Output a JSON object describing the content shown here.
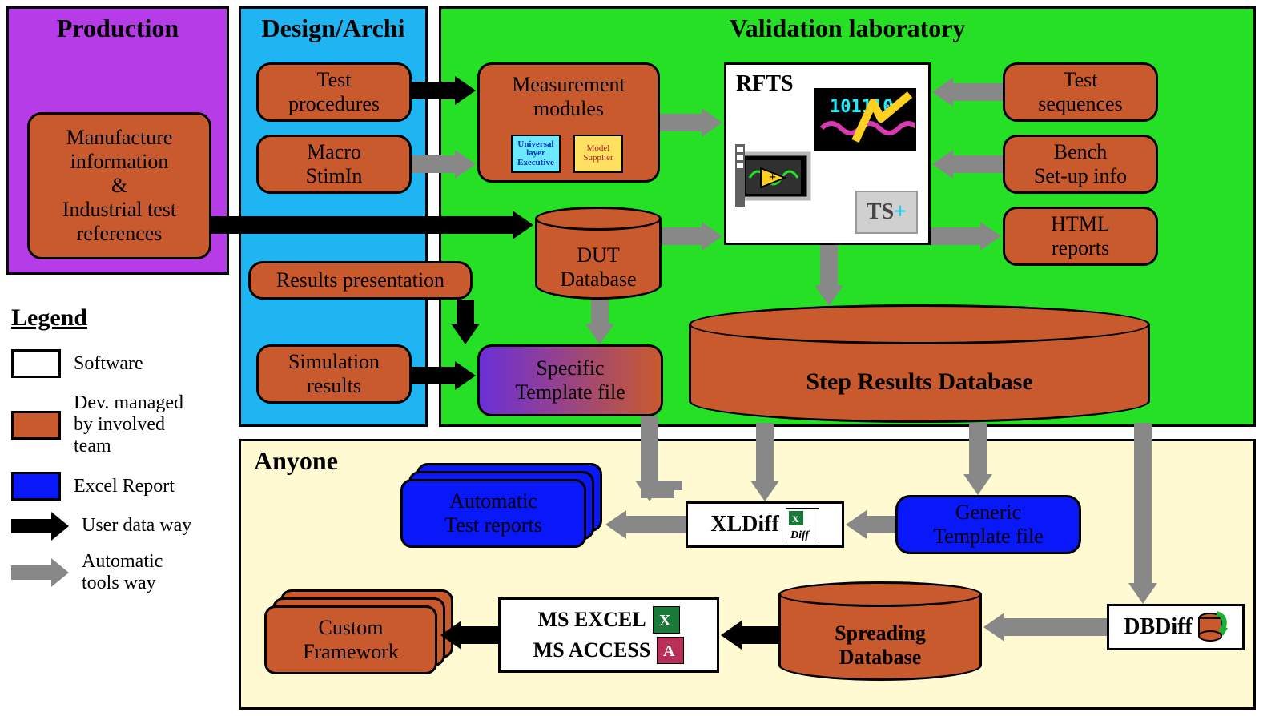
{
  "panels": {
    "production": "Production",
    "design": "Design/Archi",
    "validation": "Validation laboratory",
    "anyone": "Anyone"
  },
  "boxes": {
    "manufacture": "Manufacture\ninformation\n&\nIndustrial test\nreferences",
    "testproc": "Test\nprocedures",
    "macro": "Macro\nStimIn",
    "resultspres": "Results presentation",
    "simresults": "Simulation\nresults",
    "measmod": "Measurement\nmodules",
    "testseq": "Test\nsequences",
    "bench": "Bench\nSet-up info",
    "htmlrep": "HTML\nreports",
    "spectmpl": "Specific\nTemplate file",
    "autotest": "Automatic\nTest reports",
    "gentmpl": "Generic\nTemplate file",
    "custom": "Custom\nFramework"
  },
  "software": {
    "rfts": "RFTS",
    "xldiff": "XLDiff",
    "msexcel": "MS EXCEL",
    "msaccess": "MS ACCESS",
    "dbdiff": "DBDiff",
    "ts": "TS"
  },
  "databases": {
    "dut": "DUT\nDatabase",
    "stepres": "Step Results Database",
    "spreading": "Spreading\nDatabase"
  },
  "mini": {
    "ule": "Universal\nlayer\nExecutive",
    "model": "Model\nSupplier"
  },
  "legend": {
    "title": "Legend",
    "software": "Software",
    "dev": "Dev. managed\nby involved\nteam",
    "excel": "Excel Report",
    "userway": "User data way",
    "toolsway": "Automatic\ntools way"
  }
}
